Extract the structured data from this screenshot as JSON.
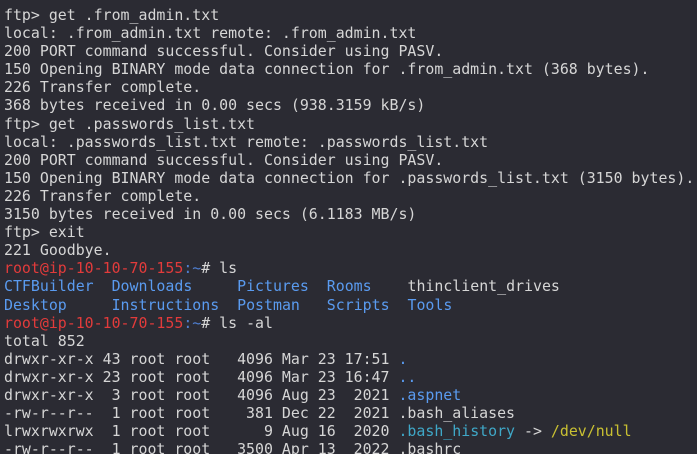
{
  "colors": {
    "background": "#2b2b33",
    "text": "#d6d6d6",
    "prompt_user": "#e23b3b",
    "prompt_path": "#4f7fd1",
    "directory": "#5a9bf0",
    "symlink": "#3fa8c8",
    "symlink_target": "#c9c032"
  },
  "lines": [
    [
      {
        "t": "ftp> get .from_admin.txt",
        "c": "plain"
      }
    ],
    [
      {
        "t": "local: .from_admin.txt remote: .from_admin.txt",
        "c": "plain"
      }
    ],
    [
      {
        "t": "200 PORT command successful. Consider using PASV.",
        "c": "plain"
      }
    ],
    [
      {
        "t": "150 Opening BINARY mode data connection for .from_admin.txt (368 bytes).",
        "c": "plain"
      }
    ],
    [
      {
        "t": "226 Transfer complete.",
        "c": "plain"
      }
    ],
    [
      {
        "t": "368 bytes received in 0.00 secs (938.3159 kB/s)",
        "c": "plain"
      }
    ],
    [
      {
        "t": "ftp> get .passwords_list.txt",
        "c": "plain"
      }
    ],
    [
      {
        "t": "local: .passwords_list.txt remote: .passwords_list.txt",
        "c": "plain"
      }
    ],
    [
      {
        "t": "200 PORT command successful. Consider using PASV.",
        "c": "plain"
      }
    ],
    [
      {
        "t": "150 Opening BINARY mode data connection for .passwords_list.txt (3150 bytes).",
        "c": "plain"
      }
    ],
    [
      {
        "t": "226 Transfer complete.",
        "c": "plain"
      }
    ],
    [
      {
        "t": "3150 bytes received in 0.00 secs (6.1183 MB/s)",
        "c": "plain"
      }
    ],
    [
      {
        "t": "ftp> exit",
        "c": "plain"
      }
    ],
    [
      {
        "t": "221 Goodbye.",
        "c": "plain"
      }
    ],
    [
      {
        "t": "root@ip-10-10-70-155",
        "c": "prompt-user"
      },
      {
        "t": ":~",
        "c": "prompt-path"
      },
      {
        "t": "# ls",
        "c": "plain"
      }
    ],
    [
      {
        "t": "CTFBuilder",
        "c": "dir"
      },
      {
        "t": "  ",
        "c": "plain"
      },
      {
        "t": "Downloads",
        "c": "dir"
      },
      {
        "t": "     ",
        "c": "plain"
      },
      {
        "t": "Pictures",
        "c": "dir"
      },
      {
        "t": "  ",
        "c": "plain"
      },
      {
        "t": "Rooms",
        "c": "dir"
      },
      {
        "t": "    ",
        "c": "plain"
      },
      {
        "t": "thinclient_drives",
        "c": "file"
      }
    ],
    [
      {
        "t": "Desktop",
        "c": "dir"
      },
      {
        "t": "     ",
        "c": "plain"
      },
      {
        "t": "Instructions",
        "c": "dir"
      },
      {
        "t": "  ",
        "c": "plain"
      },
      {
        "t": "Postman",
        "c": "dir"
      },
      {
        "t": "   ",
        "c": "plain"
      },
      {
        "t": "Scripts",
        "c": "dir"
      },
      {
        "t": "  ",
        "c": "plain"
      },
      {
        "t": "Tools",
        "c": "dir"
      }
    ],
    [
      {
        "t": "root@ip-10-10-70-155",
        "c": "prompt-user"
      },
      {
        "t": ":~",
        "c": "prompt-path"
      },
      {
        "t": "# ls -al",
        "c": "plain"
      }
    ],
    [
      {
        "t": "total 852",
        "c": "plain"
      }
    ],
    [
      {
        "t": "drwxr-xr-x 43 root root   4096 Mar 23 17:51 ",
        "c": "plain"
      },
      {
        "t": ".",
        "c": "dir"
      }
    ],
    [
      {
        "t": "drwxr-xr-x 23 root root   4096 Mar 23 16:47 ",
        "c": "plain"
      },
      {
        "t": "..",
        "c": "dir"
      }
    ],
    [
      {
        "t": "drwxr-xr-x  3 root root   4096 Aug 23  2021 ",
        "c": "plain"
      },
      {
        "t": ".aspnet",
        "c": "dir"
      }
    ],
    [
      {
        "t": "-rw-r--r--  1 root root    381 Dec 22  2021 .bash_aliases",
        "c": "plain"
      }
    ],
    [
      {
        "t": "lrwxrwxrwx  1 root root      9 Aug 16  2020 ",
        "c": "plain"
      },
      {
        "t": ".bash_history",
        "c": "link"
      },
      {
        "t": " -> ",
        "c": "plain"
      },
      {
        "t": "/dev/null",
        "c": "target"
      }
    ],
    [
      {
        "t": "-rw-r--r--  1 root root   3500 Apr 13  2022 .bashrc",
        "c": "plain"
      }
    ]
  ]
}
